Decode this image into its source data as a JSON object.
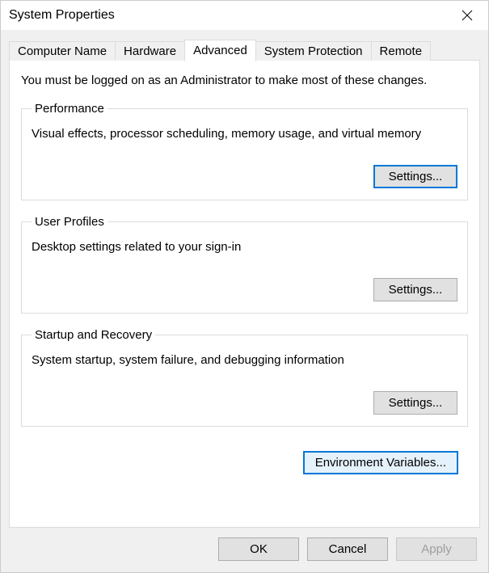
{
  "window": {
    "title": "System Properties"
  },
  "tabs": [
    {
      "label": "Computer Name"
    },
    {
      "label": "Hardware"
    },
    {
      "label": "Advanced"
    },
    {
      "label": "System Protection"
    },
    {
      "label": "Remote"
    }
  ],
  "advanced": {
    "admin_note": "You must be logged on as an Administrator to make most of these changes.",
    "groups": {
      "performance": {
        "legend": "Performance",
        "desc": "Visual effects, processor scheduling, memory usage, and virtual memory",
        "button": "Settings..."
      },
      "user_profiles": {
        "legend": "User Profiles",
        "desc": "Desktop settings related to your sign-in",
        "button": "Settings..."
      },
      "startup_recovery": {
        "legend": "Startup and Recovery",
        "desc": "System startup, system failure, and debugging information",
        "button": "Settings..."
      }
    },
    "env_button": "Environment Variables..."
  },
  "dialog_buttons": {
    "ok": "OK",
    "cancel": "Cancel",
    "apply": "Apply"
  }
}
